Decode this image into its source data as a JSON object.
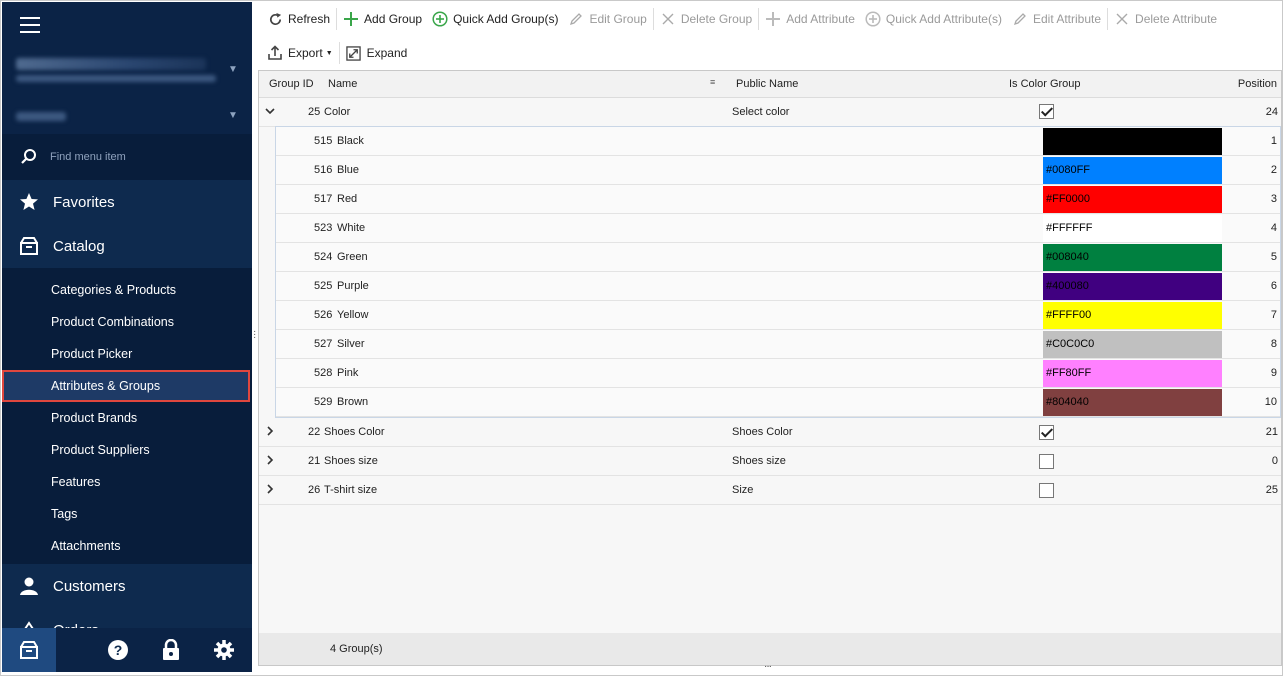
{
  "sidebar": {
    "search_placeholder": "Find menu item",
    "favorites": "Favorites",
    "catalog": "Catalog",
    "catalog_items": [
      "Categories & Products",
      "Product Combinations",
      "Product Picker",
      "Attributes & Groups",
      "Product Brands",
      "Product Suppliers",
      "Features",
      "Tags",
      "Attachments"
    ],
    "customers": "Customers",
    "orders": "Orders"
  },
  "toolbar": {
    "refresh": "Refresh",
    "add_group": "Add Group",
    "quick_add_group": "Quick Add Group(s)",
    "edit_group": "Edit Group",
    "delete_group": "Delete Group",
    "add_attribute": "Add Attribute",
    "quick_add_attribute": "Quick Add Attribute(s)",
    "edit_attribute": "Edit Attribute",
    "delete_attribute": "Delete Attribute",
    "export": "Export",
    "expand": "Expand"
  },
  "grid": {
    "columns": {
      "group_id": "Group ID",
      "name": "Name",
      "public_name": "Public Name",
      "is_color_group": "Is Color Group",
      "position": "Position"
    },
    "groups": [
      {
        "id": "25",
        "name": "Color",
        "public_name": "Select color",
        "is_color": true,
        "position": "24",
        "expanded": true
      },
      {
        "id": "22",
        "name": "Shoes Color",
        "public_name": "Shoes Color",
        "is_color": true,
        "position": "21",
        "expanded": false
      },
      {
        "id": "21",
        "name": "Shoes size",
        "public_name": "Shoes size",
        "is_color": false,
        "position": "0",
        "expanded": false
      },
      {
        "id": "26",
        "name": "T-shirt size",
        "public_name": "Size",
        "is_color": false,
        "position": "25",
        "expanded": false
      }
    ],
    "attributes": [
      {
        "id": "515",
        "name": "Black",
        "color": "#000000",
        "color_label": "",
        "position": "1"
      },
      {
        "id": "516",
        "name": "Blue",
        "color": "#0080FF",
        "color_label": "#0080FF",
        "position": "2"
      },
      {
        "id": "517",
        "name": "Red",
        "color": "#FF0000",
        "color_label": "#FF0000",
        "position": "3"
      },
      {
        "id": "523",
        "name": "White",
        "color": "#FFFFFF",
        "color_label": "#FFFFFF",
        "position": "4"
      },
      {
        "id": "524",
        "name": "Green",
        "color": "#008040",
        "color_label": "#008040",
        "position": "5"
      },
      {
        "id": "525",
        "name": "Purple",
        "color": "#400080",
        "color_label": "#400080",
        "position": "6"
      },
      {
        "id": "526",
        "name": "Yellow",
        "color": "#FFFF00",
        "color_label": "#FFFF00",
        "position": "7"
      },
      {
        "id": "527",
        "name": "Silver",
        "color": "#C0C0C0",
        "color_label": "#C0C0C0",
        "position": "8"
      },
      {
        "id": "528",
        "name": "Pink",
        "color": "#FF80FF",
        "color_label": "#FF80FF",
        "position": "9"
      },
      {
        "id": "529",
        "name": "Brown",
        "color": "#804040",
        "color_label": "#804040",
        "position": "10"
      }
    ],
    "footer": "4 Group(s)"
  },
  "colors": {
    "sidebar_bg": "#0e2a4e",
    "active_border": "#e0473e",
    "add_green": "#3aa64a"
  }
}
